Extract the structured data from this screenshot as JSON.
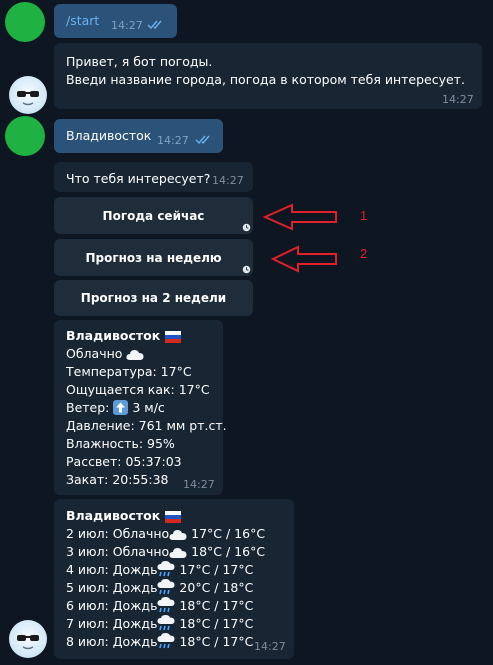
{
  "messages": {
    "start": {
      "text": "/start",
      "time": "14:27"
    },
    "greeting": {
      "line1": "Привет, я бот погоды.",
      "line2": "Введи название города, погода в котором тебя интересует.",
      "time": "14:27"
    },
    "city": {
      "text": "Владивосток",
      "time": "14:27"
    },
    "question": {
      "text": "Что тебя интересует?",
      "time": "14:27"
    }
  },
  "keyboard": {
    "now_label": "Погода сейчас",
    "week_label": "Прогноз на неделю",
    "two_weeks_label": "Прогноз на 2 недели"
  },
  "annotations": {
    "label1": "1",
    "label2": "2"
  },
  "current_weather": {
    "city": "Владивосток",
    "condition": "Облачно",
    "temperature": "Температура: 17°C",
    "feels_like": "Ощущается как: 17°C",
    "wind_prefix": "Ветер:",
    "wind_value": "3 м/с",
    "pressure": "Давление: 761 мм рт.ст.",
    "humidity": "Влажность: 95%",
    "sunrise": "Рассвет: 05:37:03",
    "sunset": "Закат: 20:55:38",
    "time": "14:27"
  },
  "forecast": {
    "city": "Владивосток",
    "days": [
      {
        "label": "2 июл: Облачно",
        "icon": "cloud-icon",
        "temps": "17°C / 16°C"
      },
      {
        "label": "3 июл: Облачно",
        "icon": "cloud-icon",
        "temps": "18°C / 16°C"
      },
      {
        "label": "4 июл: Дождь",
        "icon": "rain-cloud-icon",
        "temps": "17°C / 17°C"
      },
      {
        "label": "5 июл: Дождь",
        "icon": "rain-cloud-icon",
        "temps": "20°C / 18°C"
      },
      {
        "label": "6 июл: Дождь",
        "icon": "rain-cloud-icon",
        "temps": "18°C / 17°C"
      },
      {
        "label": "7 июл: Дождь",
        "icon": "rain-cloud-icon",
        "temps": "18°C / 17°C"
      },
      {
        "label": "8 июл: Дождь",
        "icon": "rain-cloud-icon",
        "temps": "18°C / 17°C"
      }
    ],
    "time": "14:27"
  },
  "colors": {
    "background": "#0e1621",
    "outgoing_bubble": "#2b5278",
    "incoming_bubble": "#182533",
    "keyboard_button": "#1f2c3a",
    "annotation": "#e0202a",
    "user_avatar": "#1fb141"
  }
}
